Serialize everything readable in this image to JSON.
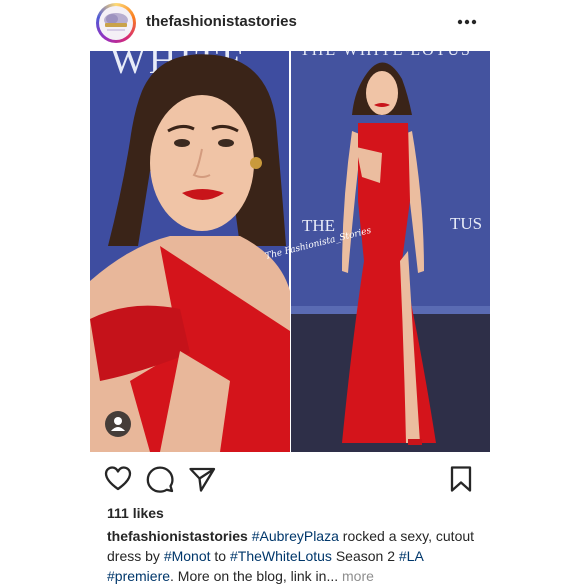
{
  "post": {
    "username": "thefashionistastories",
    "watermark": "The Fashionista_Stories",
    "backdrop_left_text": "WHITE",
    "backdrop_top_text": "THE WHITE LOTUS",
    "backdrop_right_left": "THE",
    "backdrop_right_right": "TUS"
  },
  "icons": {
    "more": "more-dots-icon",
    "like": "heart-icon",
    "comment": "comment-icon",
    "share": "send-icon",
    "save": "bookmark-icon",
    "user_tag": "user-tag-icon"
  },
  "engagement": {
    "likes": "111 likes"
  },
  "caption": {
    "username": "thefashionistastories",
    "t1": " ",
    "h1": "#AubreyPlaza",
    "t2": " rocked a sexy, cutout dress by ",
    "h2": "#Monot",
    "t3": " to ",
    "h3": "#TheWhiteLotus",
    "t4": " Season 2 ",
    "h4": "#LA",
    "t5": " ",
    "h5": "#premiere",
    "t6": ". More on the blog, link in... ",
    "more": "more"
  },
  "colors": {
    "backdrop": "#3b4a9a",
    "dress": "#d4141b",
    "hashtag": "#00376b",
    "muted": "#8e8e8e"
  }
}
